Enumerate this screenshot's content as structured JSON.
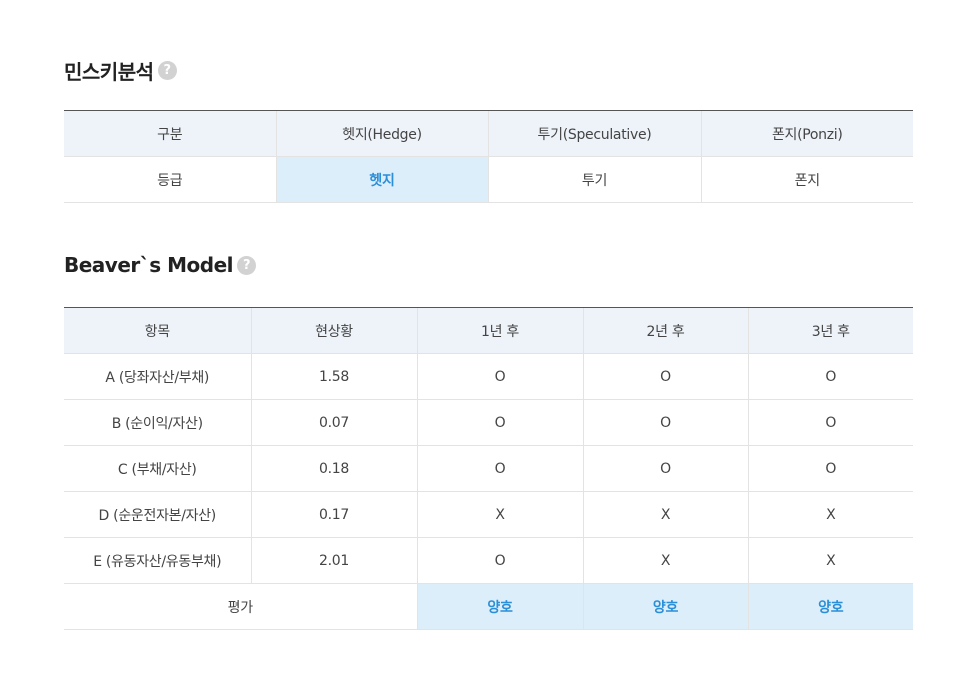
{
  "minsky": {
    "title": "민스키분석",
    "help_glyph": "?",
    "headers": [
      "구분",
      "헷지(Hedge)",
      "투기(Speculative)",
      "폰지(Ponzi)"
    ],
    "row": {
      "label": "등급",
      "values": [
        "헷지",
        "투기",
        "폰지"
      ],
      "highlighted_index": 0
    }
  },
  "beaver": {
    "title": "Beaver`s Model",
    "help_glyph": "?",
    "headers": [
      "항목",
      "현상황",
      "1년 후",
      "2년 후",
      "3년 후"
    ],
    "rows": [
      {
        "item": "A (당좌자산/부채)",
        "current": "1.58",
        "y1": "O",
        "y2": "O",
        "y3": "O"
      },
      {
        "item": "B (순이익/자산)",
        "current": "0.07",
        "y1": "O",
        "y2": "O",
        "y3": "O"
      },
      {
        "item": "C (부채/자산)",
        "current": "0.18",
        "y1": "O",
        "y2": "O",
        "y3": "O"
      },
      {
        "item": "D (순운전자본/자산)",
        "current": "0.17",
        "y1": "X",
        "y2": "X",
        "y3": "X"
      },
      {
        "item": "E (유동자산/유동부채)",
        "current": "2.01",
        "y1": "O",
        "y2": "X",
        "y3": "X"
      }
    ],
    "evaluation": {
      "label": "평가",
      "y1": "양호",
      "y2": "양호",
      "y3": "양호"
    }
  },
  "colors": {
    "header_bg": "#eef3fa",
    "highlight_bg": "#ddeefb",
    "highlight_text": "#2b8fd8",
    "help_icon": "#d2d2d2"
  }
}
